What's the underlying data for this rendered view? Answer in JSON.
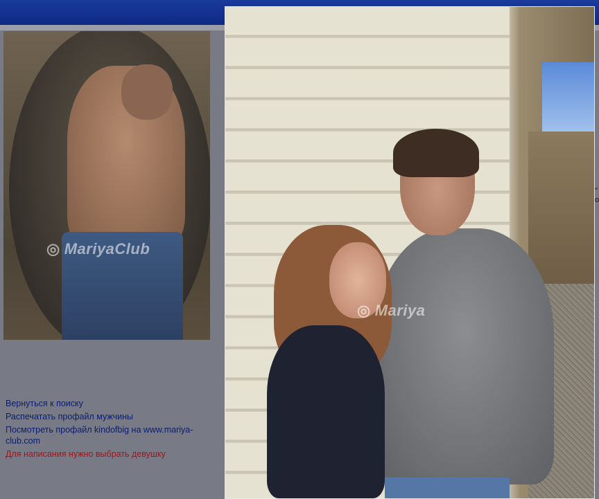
{
  "watermark": {
    "brand": "Mariya",
    "brand_full": "MariyaClub"
  },
  "links": {
    "back_to_search": "Вернуться к поиску",
    "print_profile": "Распечатать профайл мужчины",
    "view_profile": "Посмотреть профайл kindofbig на www.mariya-club.com",
    "must_choose": "Для написания нужно выбрать девушку"
  },
  "edge": {
    "line1": "\"",
    "line2": "o"
  }
}
